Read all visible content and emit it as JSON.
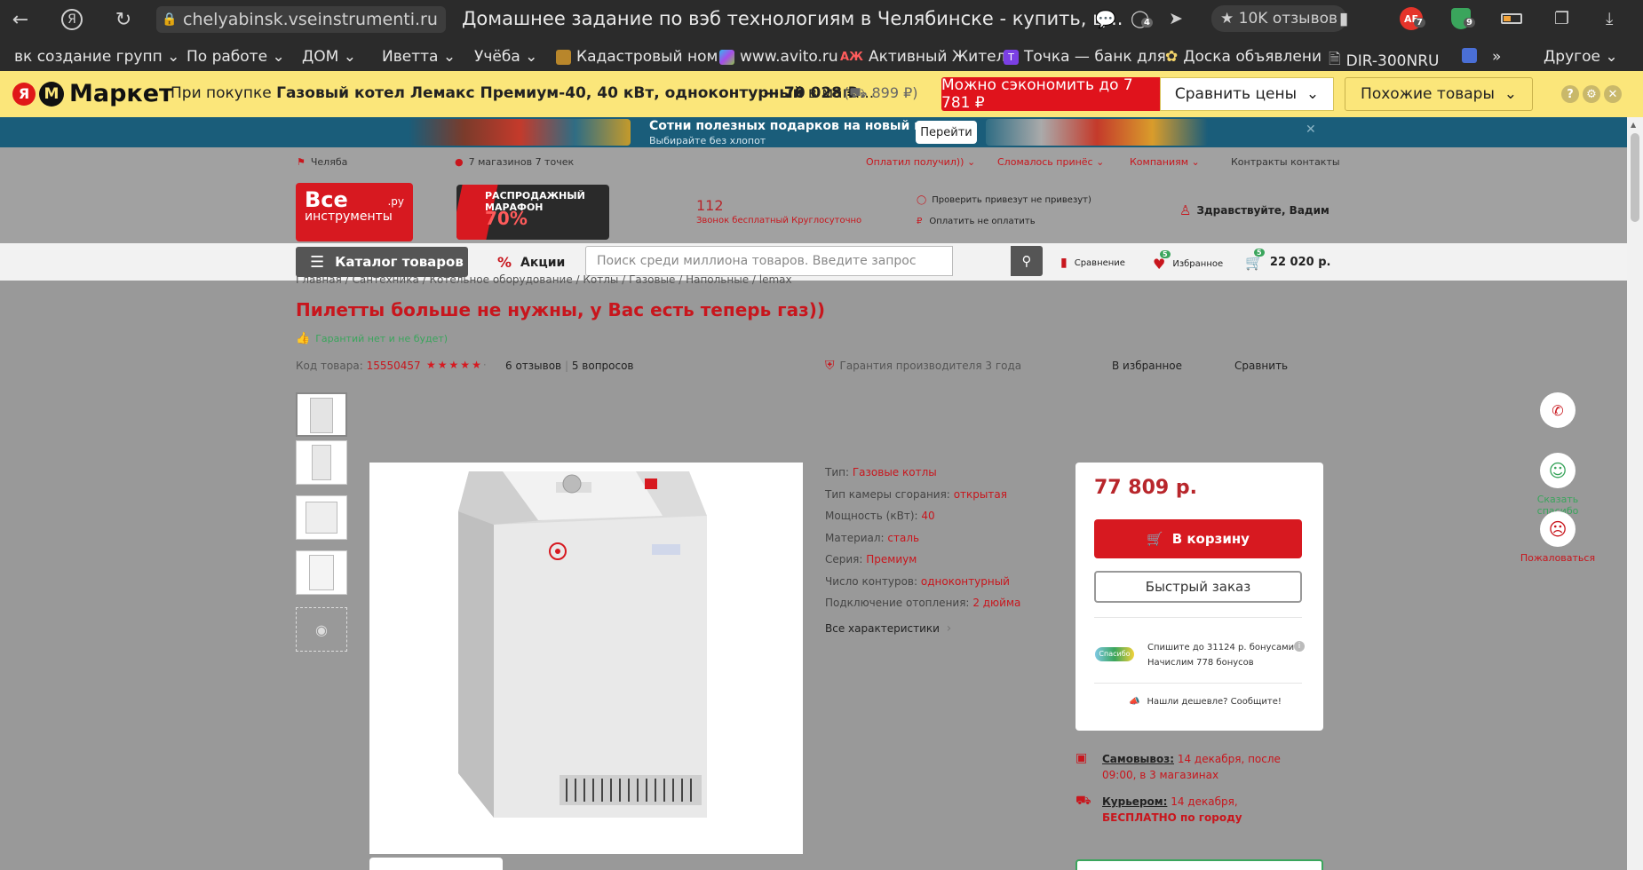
{
  "browser": {
    "url": "chelyabinsk.vseinstrumenti.ru",
    "tab_title": "Домашнее задание по вэб технологиям в Челябинске - купить, ц...",
    "reviews_btn": "10K отзывов",
    "badges": {
      "ext1": "4",
      "ae": "7",
      "ext2": "9"
    },
    "bookmarks": [
      "вк создание групп",
      "По работе",
      "ДОМ",
      "Иветта",
      "Учёба",
      "Кадастровый ном",
      "www.avito.ru",
      "Активный Жител",
      "Точка — банк для",
      "Доска объявлени",
      "DIR-300NRU",
      "Другое"
    ]
  },
  "market": {
    "brand": "Маркет",
    "text_prefix": "При покупке",
    "text_product": "Газовый котел Лемакс Премиум-40, 40 кВт, одноконтурный",
    "text_suffix": "в мага...",
    "price": "— 70 028 ₽",
    "delivery": "899 ₽)",
    "save_btn": "Можно сэкономить до 7 781 ₽",
    "compare_btn": "Сравнить цены",
    "similar_btn": "Похожие товары"
  },
  "banner": {
    "title": "Сотни полезных подарков на новый год",
    "subtitle": "Выбирайте без хлопот",
    "button": "Перейти"
  },
  "topline": {
    "city": "Челяба",
    "stores": "7 магазинов 7 точек",
    "links": [
      "Оплатил получил))",
      "Сломалось принёс",
      "Компаниям",
      "Контракты контакты"
    ]
  },
  "header": {
    "logo_line1": "Все",
    "logo_line2": "инструменты",
    "logo_ru": ".ру",
    "promo_line1": "РАСПРОДАЖНЫЙ",
    "promo_line2": "МАРАФОН",
    "promo_pct": "70%",
    "phone": "112",
    "phone_note": "Звонок бесплатный Круглосуточно",
    "check": "Проверить привезут не привезут)",
    "pay": "Оплатить не оплатить",
    "greeting": "Здравствуйте, Вадим"
  },
  "nav": {
    "catalog": "Каталог товаров",
    "promo": "Акции",
    "search_placeholder": "Поиск среди миллиона товаров. Введите запрос",
    "compare": "Сравнение",
    "favorites": "Избранное",
    "fav_count": "5",
    "cart_count": "5",
    "cart_total": "22 020 р."
  },
  "product": {
    "breadcrumb": "Главная / Сантехника / Котельное оборудование / Котлы / Газовые / Напольные / lemax",
    "title": "Пилетты больше не нужны, у Вас есть теперь газ))",
    "guarantee_note": "Гарантий нет и не будет)",
    "code_label": "Код товара:",
    "code": "15550457",
    "rating": 5,
    "reviews": "6 отзывов",
    "questions": "5 вопросов",
    "warranty": "Гарантия производителя 3 года",
    "to_favorites": "В избранное",
    "compare": "Сравнить",
    "specs": [
      {
        "label": "Тип:",
        "value": "Газовые котлы"
      },
      {
        "label": "Тип камеры сгорания:",
        "value": "открытая"
      },
      {
        "label": "Мощность (кВт):",
        "value": "40"
      },
      {
        "label": "Материал:",
        "value": "сталь"
      },
      {
        "label": "Серия:",
        "value": "Премиум"
      },
      {
        "label": "Число контуров:",
        "value": "одноконтурный"
      },
      {
        "label": "Подключение отопления:",
        "value": "2 дюйма"
      }
    ],
    "all_specs": "Все характеристики",
    "price": "77 809 р.",
    "to_cart": "В корзину",
    "quick_order": "Быстрый заказ",
    "spasibo_logo": "Спасибо",
    "bonus_line1": "Спишите до 31124 р. бонусами",
    "bonus_line2": "Начислим 778 бонусов",
    "cheaper": "Нашли дешевле? Сообщите!",
    "pickup_label": "Самовывоз:",
    "pickup_value": "14 декабря, после 09:00, в 3 магазинах",
    "courier_label": "Курьером:",
    "courier_date": "14 декабря,",
    "courier_free": "БЕСПЛАТНО по городу"
  },
  "floating": {
    "thanks": "Сказать спасибо",
    "complain": "Пожаловаться"
  }
}
